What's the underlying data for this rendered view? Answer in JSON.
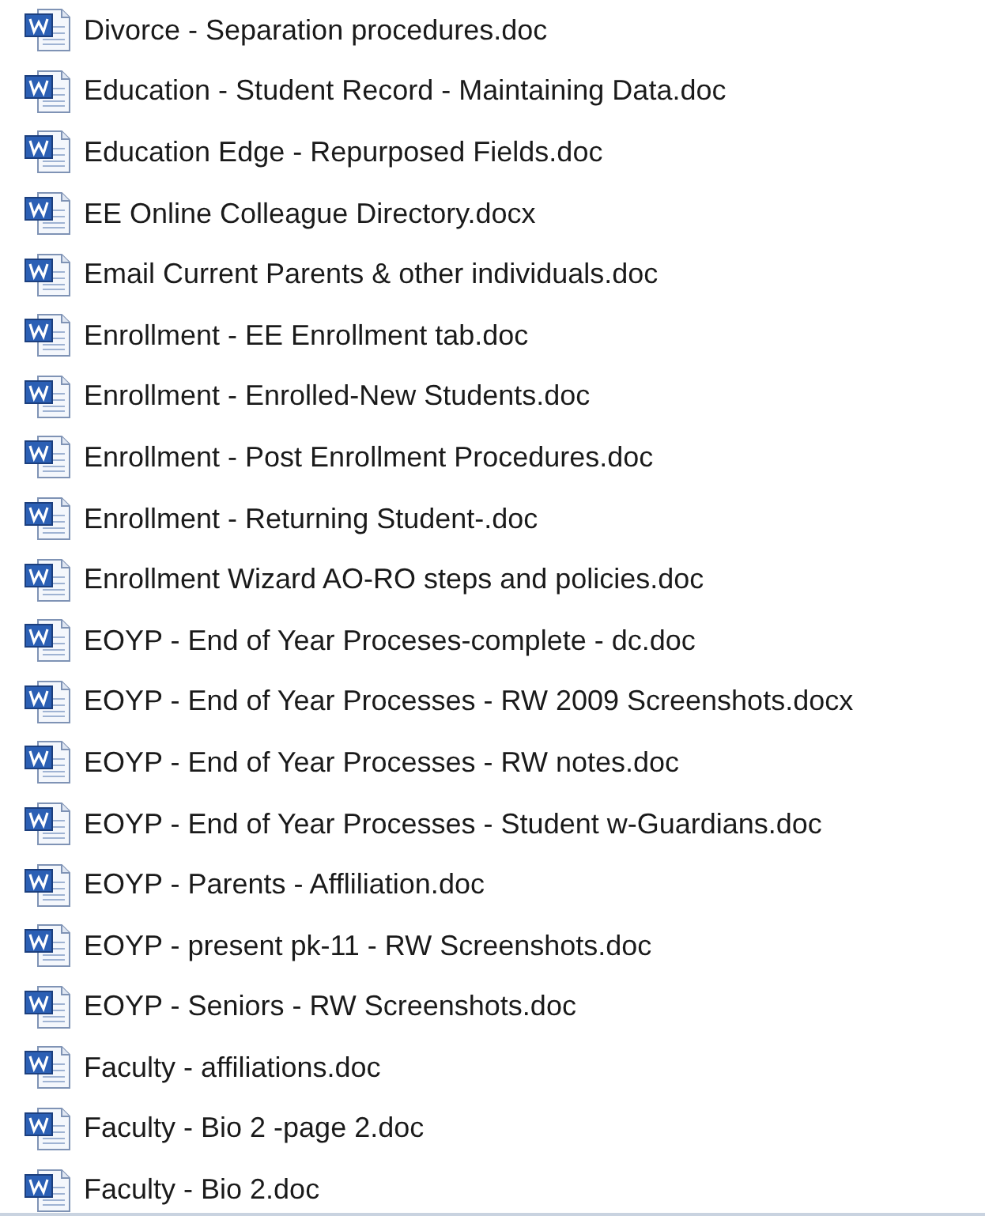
{
  "files": [
    {
      "name": "Divorce - Separation procedures.doc"
    },
    {
      "name": "Education - Student Record - Maintaining Data.doc"
    },
    {
      "name": "Education Edge - Repurposed Fields.doc"
    },
    {
      "name": "EE Online Colleague Directory.docx"
    },
    {
      "name": "Email Current Parents & other individuals.doc"
    },
    {
      "name": "Enrollment - EE Enrollment tab.doc"
    },
    {
      "name": "Enrollment - Enrolled-New Students.doc"
    },
    {
      "name": "Enrollment - Post Enrollment Procedures.doc"
    },
    {
      "name": "Enrollment - Returning Student-.doc"
    },
    {
      "name": "Enrollment Wizard AO-RO steps and policies.doc"
    },
    {
      "name": "EOYP - End of Year Proceses-complete - dc.doc"
    },
    {
      "name": "EOYP - End of Year Processes - RW 2009 Screenshots.docx"
    },
    {
      "name": "EOYP - End of Year Processes - RW notes.doc"
    },
    {
      "name": "EOYP - End of Year Processes - Student w-Guardians.doc"
    },
    {
      "name": "EOYP - Parents - Affliliation.doc"
    },
    {
      "name": "EOYP - present pk-11 - RW Screenshots.doc"
    },
    {
      "name": "EOYP - Seniors - RW Screenshots.doc"
    },
    {
      "name": "Faculty - affiliations.doc"
    },
    {
      "name": "Faculty - Bio 2 -page 2.doc"
    },
    {
      "name": "Faculty - Bio 2.doc"
    }
  ]
}
